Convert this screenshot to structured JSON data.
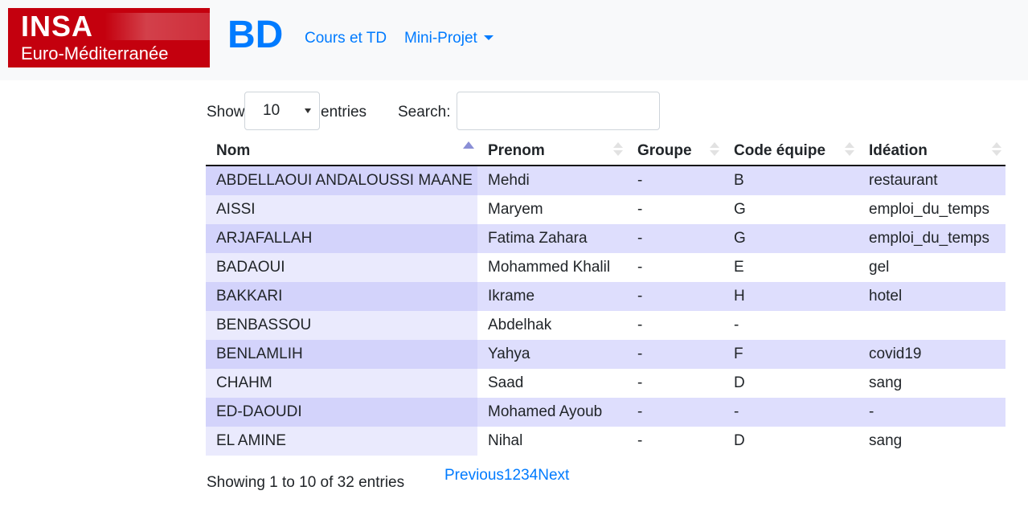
{
  "logo": {
    "line1": "INSA",
    "line2": "Euro-Méditerranée"
  },
  "navbar": {
    "brand": "BD",
    "links": [
      {
        "label": "Cours et TD"
      },
      {
        "label": "Mini-Projet"
      }
    ]
  },
  "controls": {
    "show_label": "Show",
    "length_value": "10",
    "entries_label": "entries",
    "search_label": "Search:",
    "search_value": ""
  },
  "table": {
    "columns": [
      "Nom",
      "Prenom",
      "Groupe",
      "Code équipe",
      "Idéation"
    ],
    "sorted_column": "Nom",
    "sort_direction": "ascending",
    "rows": [
      [
        "ABDELLAOUI ANDALOUSSI MAANE",
        "Mehdi",
        "-",
        "B",
        "restaurant"
      ],
      [
        "AISSI",
        "Maryem",
        "-",
        "G",
        "emploi_du_temps"
      ],
      [
        "ARJAFALLAH",
        "Fatima Zahara",
        "-",
        "G",
        "emploi_du_temps"
      ],
      [
        "BADAOUI",
        "Mohammed Khalil",
        "-",
        "E",
        "gel"
      ],
      [
        "BAKKARI",
        "Ikrame",
        "-",
        "H",
        "hotel"
      ],
      [
        "BENBASSOU",
        "Abdelhak",
        "-",
        "-",
        ""
      ],
      [
        "BENLAMLIH",
        "Yahya",
        "-",
        "F",
        "covid19"
      ],
      [
        "CHAHM",
        "Saad",
        "-",
        "D",
        "sang"
      ],
      [
        "ED-DAOUDI",
        "Mohamed Ayoub",
        "-",
        "-",
        "-"
      ],
      [
        "EL AMINE",
        "Nihal",
        "-",
        "D",
        "sang"
      ]
    ]
  },
  "footer": {
    "info": "Showing 1 to 10 of 32 entries",
    "pagination": [
      "Previous",
      "1",
      "2",
      "3",
      "4",
      "Next"
    ]
  }
}
